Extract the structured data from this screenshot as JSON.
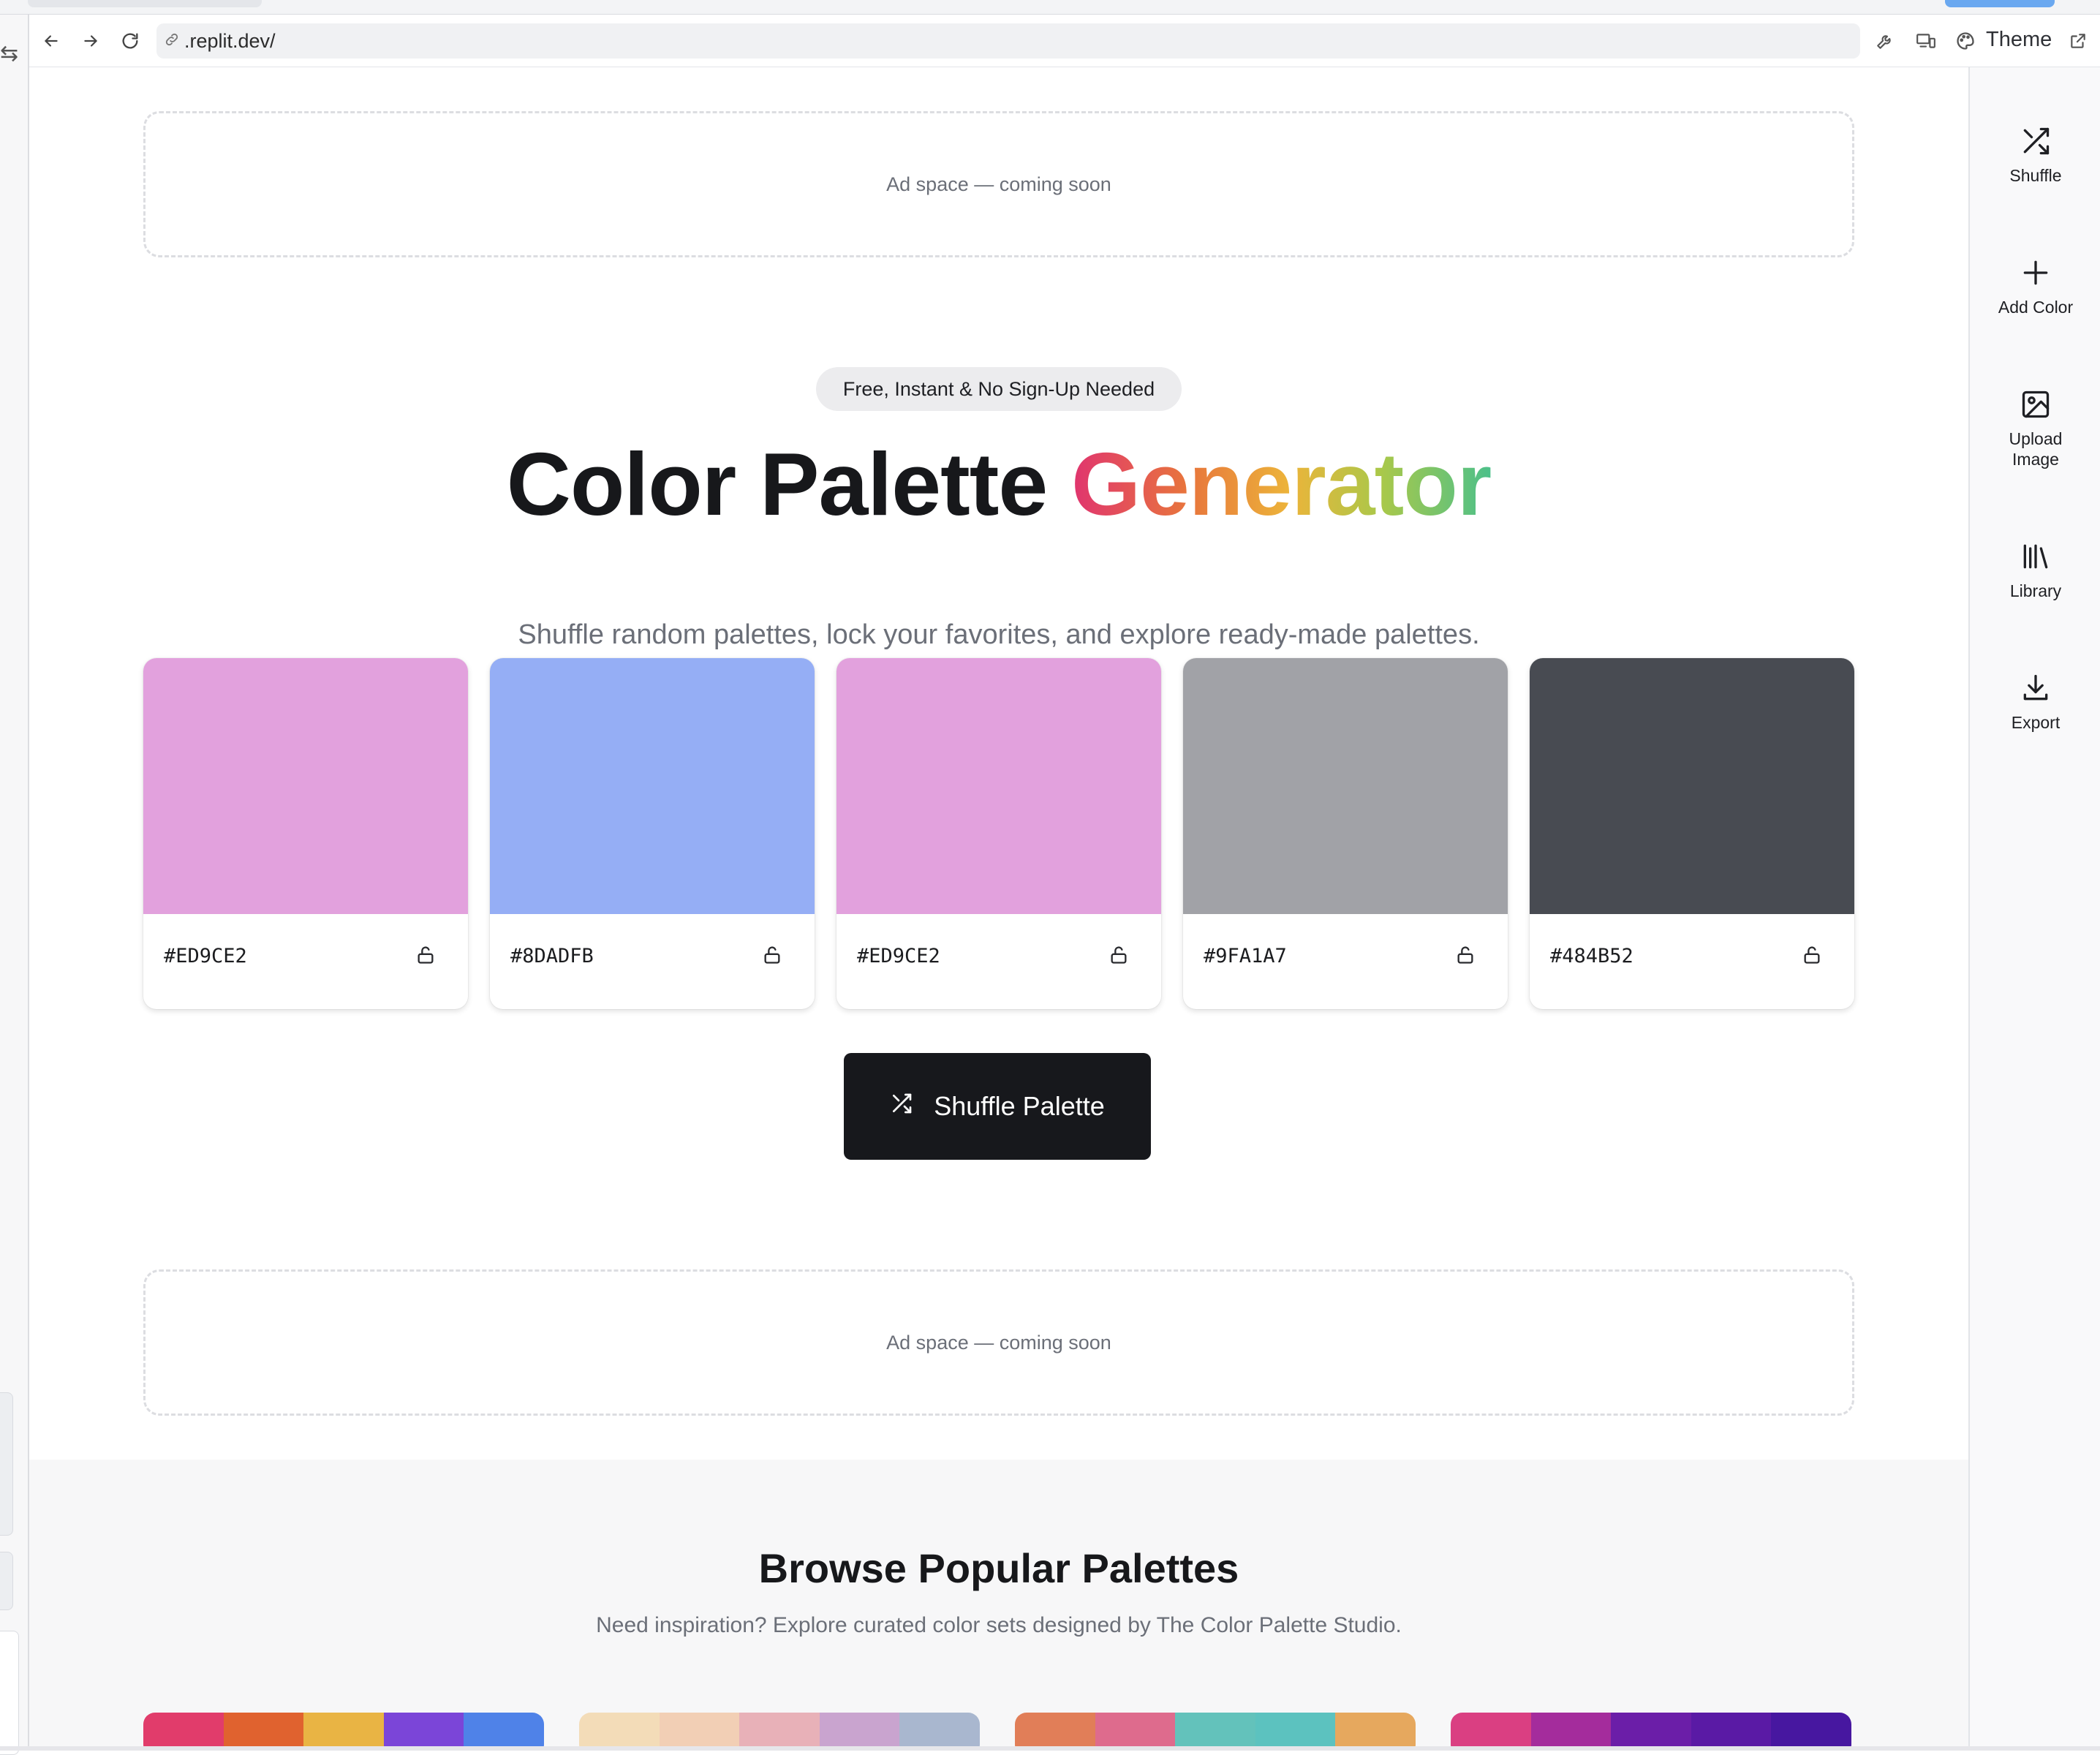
{
  "browser": {
    "url": ".replit.dev/",
    "theme_label": "Theme"
  },
  "ads": {
    "top_text": "Ad space — coming soon",
    "bottom_text": "Ad space — coming soon"
  },
  "hero": {
    "badge": "Free, Instant & No Sign-Up Needed",
    "title_main": "Color Palette ",
    "title_accent": "Generator",
    "subtitle": "Shuffle random palettes, lock your favorites, and explore ready-made palettes."
  },
  "palette": [
    {
      "hex": "#ED9CE2",
      "color": "#E2A1DD",
      "locked": false
    },
    {
      "hex": "#8DADFB",
      "color": "#95AEF5",
      "locked": false
    },
    {
      "hex": "#ED9CE2",
      "color": "#E2A1DD",
      "locked": false
    },
    {
      "hex": "#9FA1A7",
      "color": "#A1A2A7",
      "locked": false
    },
    {
      "hex": "#484B52",
      "color": "#484B52",
      "locked": false
    }
  ],
  "actions": {
    "shuffle_label": "Shuffle Palette"
  },
  "browse": {
    "title": "Browse Popular Palettes",
    "subtitle": "Need inspiration? Explore curated color sets designed by The Color Palette Studio.",
    "previews": [
      [
        "#E13C6B",
        "#E0622F",
        "#E9B444",
        "#7B45D8",
        "#4F82E8"
      ],
      [
        "#F3DCB8",
        "#F2CFB5",
        "#E8B1B8",
        "#C9A4CF",
        "#A9B7CF"
      ],
      [
        "#E17E58",
        "#DE6B8D",
        "#63C2BB",
        "#5CC2BF",
        "#E6A85E"
      ],
      [
        "#DA3F82",
        "#A42C9C",
        "#6B1EA8",
        "#5A1AA5",
        "#4717A0"
      ]
    ]
  },
  "sidebar": {
    "items": [
      {
        "label": "Shuffle",
        "icon": "shuffle-icon"
      },
      {
        "label": "Add Color",
        "icon": "plus-icon"
      },
      {
        "label": "Upload Image",
        "icon": "image-icon"
      },
      {
        "label": "Library",
        "icon": "library-icon"
      },
      {
        "label": "Export",
        "icon": "download-icon"
      }
    ]
  },
  "colors": {
    "title_gradient": [
      "#E0346F",
      "#E8763C",
      "#ECB43A",
      "#A9C84A",
      "#4CC08A"
    ],
    "button_bg": "#17181C"
  }
}
